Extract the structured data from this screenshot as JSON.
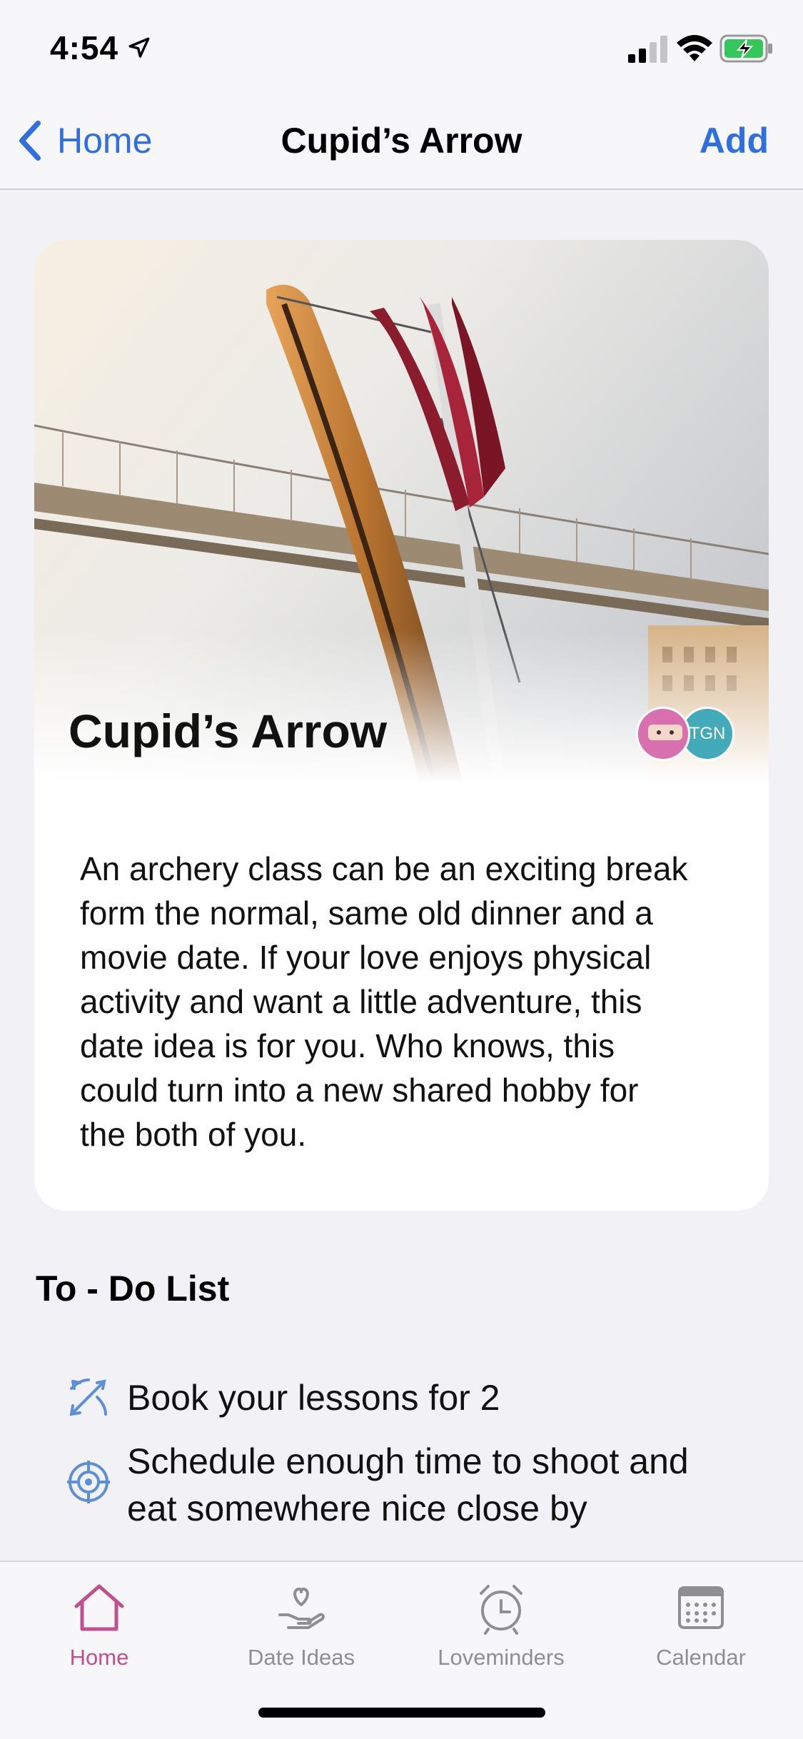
{
  "status_bar": {
    "time": "4:54"
  },
  "nav": {
    "back_label": "Home",
    "title": "Cupid’s Arrow",
    "add_label": "Add"
  },
  "card": {
    "title": "Cupid’s Arrow",
    "avatar_initials": "TGN",
    "description": "An archery class can be an exciting break\nform the normal, same old dinner and a\nmovie date.  If your love enjoys physical\nactivity and want a little adventure, this\ndate idea is for you.  Who knows, this\ncould turn into a new shared hobby for\nthe both of you."
  },
  "todo": {
    "title": "To - Do List",
    "items": [
      {
        "icon": "archery-icon",
        "text": "Book your lessons for 2"
      },
      {
        "icon": "target-icon",
        "text": "Schedule enough time to shoot and\neat somewhere nice close by"
      }
    ]
  },
  "tabs": [
    {
      "label": "Home",
      "icon": "house-icon",
      "active": true
    },
    {
      "label": "Date Ideas",
      "icon": "heart-hand-icon",
      "active": false
    },
    {
      "label": "Loveminders",
      "icon": "alarm-clock-icon",
      "active": false
    },
    {
      "label": "Calendar",
      "icon": "calendar-icon",
      "active": false
    }
  ],
  "colors": {
    "accent": "#2f6fe0",
    "active_tab": "#c0508f",
    "background": "#f1f1f6"
  }
}
